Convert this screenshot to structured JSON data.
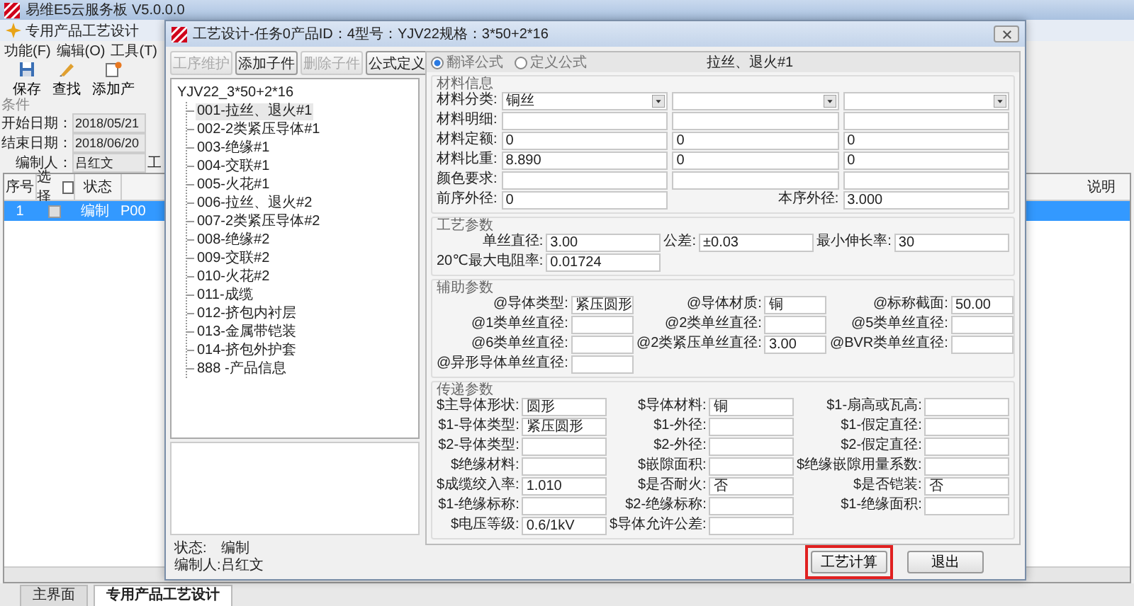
{
  "app": {
    "title": "易维E5云服务板 V5.0.0.0",
    "doc_title": "专用产品工艺设计",
    "menu": [
      "功能(F)",
      "编辑(O)",
      "工具(T)"
    ],
    "toolbar": [
      {
        "label": "保存",
        "kind": "save"
      },
      {
        "label": "查找",
        "kind": "find"
      },
      {
        "label": "添加产",
        "kind": "add"
      }
    ],
    "conditions": {
      "legend": "条件",
      "fields": [
        {
          "label": "开始日期：",
          "value": "2018/05/21"
        },
        {
          "label": "结束日期：",
          "value": "2018/06/20"
        },
        {
          "label": "编制人：",
          "value": "吕红文"
        }
      ],
      "cut_label": "工"
    },
    "table": {
      "columns": [
        "序号",
        "选择",
        "状态",
        "说明"
      ],
      "header_checked": false,
      "rows": [
        {
          "no": "1",
          "checked": false,
          "status": "编制",
          "code": "P00",
          "selected": true
        }
      ]
    },
    "tabs": [
      {
        "label": "主界面",
        "selected": false
      },
      {
        "label": "专用产品工艺设计",
        "selected": true
      }
    ]
  },
  "dialog": {
    "title": "工艺设计-任务0产品ID：4型号：YJV22规格：3*50+2*16",
    "toolbar": [
      {
        "label": "工序维护",
        "disabled": true
      },
      {
        "label": "添加子件",
        "disabled": false
      },
      {
        "label": "删除子件",
        "disabled": true
      },
      {
        "label": "公式定义",
        "disabled": false
      }
    ],
    "tree": {
      "label": "YJV22_3*50+2*16",
      "children": [
        {
          "label": "001-拉丝、退火#1",
          "selected": true
        },
        {
          "label": "002-2类紧压导体#1",
          "selected": false
        },
        {
          "label": "003-绝缘#1",
          "selected": false
        },
        {
          "label": "004-交联#1",
          "selected": false
        },
        {
          "label": "005-火花#1",
          "selected": false
        },
        {
          "label": "006-拉丝、退火#2",
          "selected": false
        },
        {
          "label": "007-2类紧压导体#2",
          "selected": false
        },
        {
          "label": "008-绝缘#2",
          "selected": false
        },
        {
          "label": "009-交联#2",
          "selected": false
        },
        {
          "label": "010-火花#2",
          "selected": false
        },
        {
          "label": "011-成缆",
          "selected": false
        },
        {
          "label": "012-挤包内衬层",
          "selected": false
        },
        {
          "label": "013-金属带铠装",
          "selected": false
        },
        {
          "label": "014-挤包外护套",
          "selected": false
        },
        {
          "label": "888 -产品信息",
          "selected": false
        }
      ]
    },
    "status": [
      {
        "label": "状态:",
        "value": "编制"
      },
      {
        "label": "编制人:",
        "value": "吕红文"
      }
    ],
    "modes": [
      {
        "label": "翻译公式",
        "selected": true
      },
      {
        "label": "定义公式",
        "selected": false
      }
    ],
    "step_title": "拉丝、退火#1",
    "material": {
      "legend": "材料信息",
      "rows": [
        {
          "label": "材料分类:",
          "kind": "select",
          "cells": [
            {
              "value": "铜丝"
            },
            {},
            {}
          ]
        },
        {
          "label": "材料明细:",
          "kind": "text",
          "cells": [
            {},
            {},
            {}
          ]
        },
        {
          "label": "材料定额:",
          "kind": "text",
          "cells": [
            {
              "value": "0"
            },
            {
              "value": "0"
            },
            {
              "value": "0"
            }
          ]
        },
        {
          "label": "材料比重:",
          "kind": "text",
          "cells": [
            {
              "value": "8.890"
            },
            {
              "value": "0"
            },
            {
              "value": "0"
            }
          ]
        },
        {
          "label": "颜色要求:",
          "kind": "text",
          "cells": [
            {},
            {},
            {}
          ]
        }
      ],
      "prev": {
        "label": "前序外径:",
        "value": "0"
      },
      "current": {
        "label": "本序外径:",
        "value": "3.000"
      }
    },
    "groups": [
      {
        "legend": "工艺参数",
        "fields": [
          {
            "label": "单丝直径:",
            "value": "3.00"
          },
          {
            "label": "公差:",
            "value": "±0.03"
          },
          {
            "label": "最小伸长率:",
            "value": "30"
          },
          {
            "label": "20℃最大电阻率:",
            "value": "0.01724"
          }
        ]
      },
      {
        "legend": "辅助参数",
        "fields": [
          {
            "label": "@导体类型:",
            "value": "紧压圆形"
          },
          {
            "label": "@导体材质:",
            "value": "铜"
          },
          {
            "label": "@标称截面:",
            "value": "50.00"
          },
          {
            "label": "@1类单丝直径:"
          },
          {
            "label": "@2类单丝直径:"
          },
          {
            "label": "@5类单丝直径:"
          },
          {
            "label": "@6类单丝直径:"
          },
          {
            "label": "@2类紧压单丝直径:",
            "value": "3.00"
          },
          {
            "label": "@BVR类单丝直径:"
          },
          {
            "label": "@异形导体单丝直径:"
          }
        ]
      },
      {
        "legend": "传递参数",
        "fields": [
          {
            "label": "$主导体形状:",
            "value": "圆形"
          },
          {
            "label": "$导体材料:",
            "value": "铜"
          },
          {
            "label": "$1-扇高或瓦高:"
          },
          {
            "label": "$1-导体类型:",
            "value": "紧压圆形"
          },
          {
            "label": "$1-外径:"
          },
          {
            "label": "$1-假定直径:"
          },
          {
            "label": "$2-导体类型:"
          },
          {
            "label": "$2-外径:"
          },
          {
            "label": "$2-假定直径:"
          },
          {
            "label": "$绝缘材料:"
          },
          {
            "label": "$嵌隙面积:"
          },
          {
            "label": "$绝缘嵌隙用量系数:"
          },
          {
            "label": "$成缆绞入率:",
            "value": "1.010"
          },
          {
            "label": "$是否耐火:",
            "value": "否"
          },
          {
            "label": "$是否铠装:",
            "value": "否"
          },
          {
            "label": "$1-绝缘标称:"
          },
          {
            "label": "$2-绝缘标称:"
          },
          {
            "label": "$1-绝缘面积:"
          },
          {
            "label": "$电压等级:",
            "value": "0.6/1kV"
          },
          {
            "label": "$导体允许公差:"
          }
        ]
      }
    ],
    "buttons": [
      {
        "label": "工艺计算",
        "highlighted": true
      },
      {
        "label": "退出",
        "highlighted": false
      }
    ]
  }
}
